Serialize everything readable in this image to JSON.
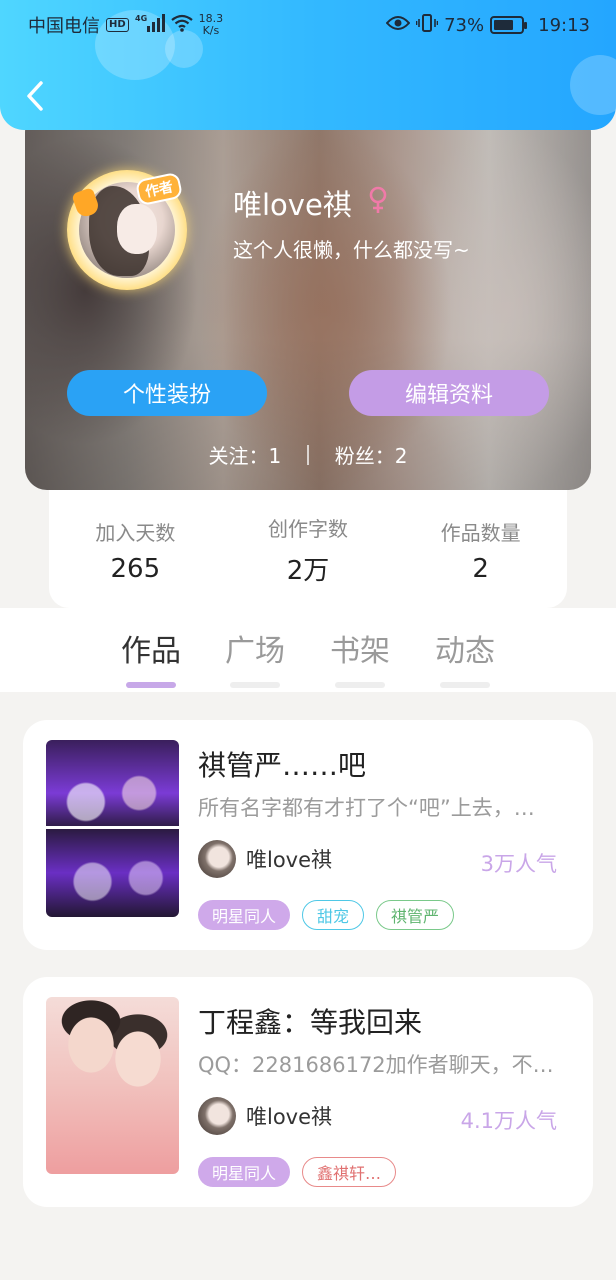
{
  "status_bar": {
    "carrier": "中国电信",
    "hd": "HD",
    "network": "4G",
    "speed_value": "18.3",
    "speed_unit": "K/s",
    "battery_percent": "73%",
    "battery_level": 0.73,
    "time": "19:13"
  },
  "profile": {
    "author_badge": "作者",
    "name": "唯love祺",
    "bio": "这个人很懒，什么都没写~",
    "dress_button": "个性装扮",
    "edit_button": "编辑资料",
    "following": "关注：1",
    "fans": "粉丝：2"
  },
  "stats": [
    {
      "label": "加入天数",
      "value": "265"
    },
    {
      "label": "创作字数",
      "value": "2万"
    },
    {
      "label": "作品数量",
      "value": "2"
    }
  ],
  "tabs": [
    {
      "label": "作品",
      "active": true
    },
    {
      "label": "广场",
      "active": false
    },
    {
      "label": "书架",
      "active": false
    },
    {
      "label": "动态",
      "active": false
    }
  ],
  "works": [
    {
      "title": "祺管严……吧",
      "desc": "所有名字都有才打了个“吧”上去，…",
      "author": "唯love祺",
      "popularity": "3万人气",
      "tags": [
        "明星同人",
        "甜宠",
        "祺管严"
      ]
    },
    {
      "title": "丁程鑫：等我回来",
      "desc": "QQ：2281686172加作者聊天，不…",
      "author": "唯love祺",
      "popularity": "4.1万人气",
      "tags": [
        "明星同人",
        "鑫祺轩…"
      ]
    }
  ],
  "colors": {
    "header_gradient_start": "#4fd6ff",
    "header_gradient_end": "#24a6ff",
    "dress_button": "#2aa2f5",
    "edit_button": "#c49ce6",
    "accent_purple": "#c9a6e8"
  }
}
